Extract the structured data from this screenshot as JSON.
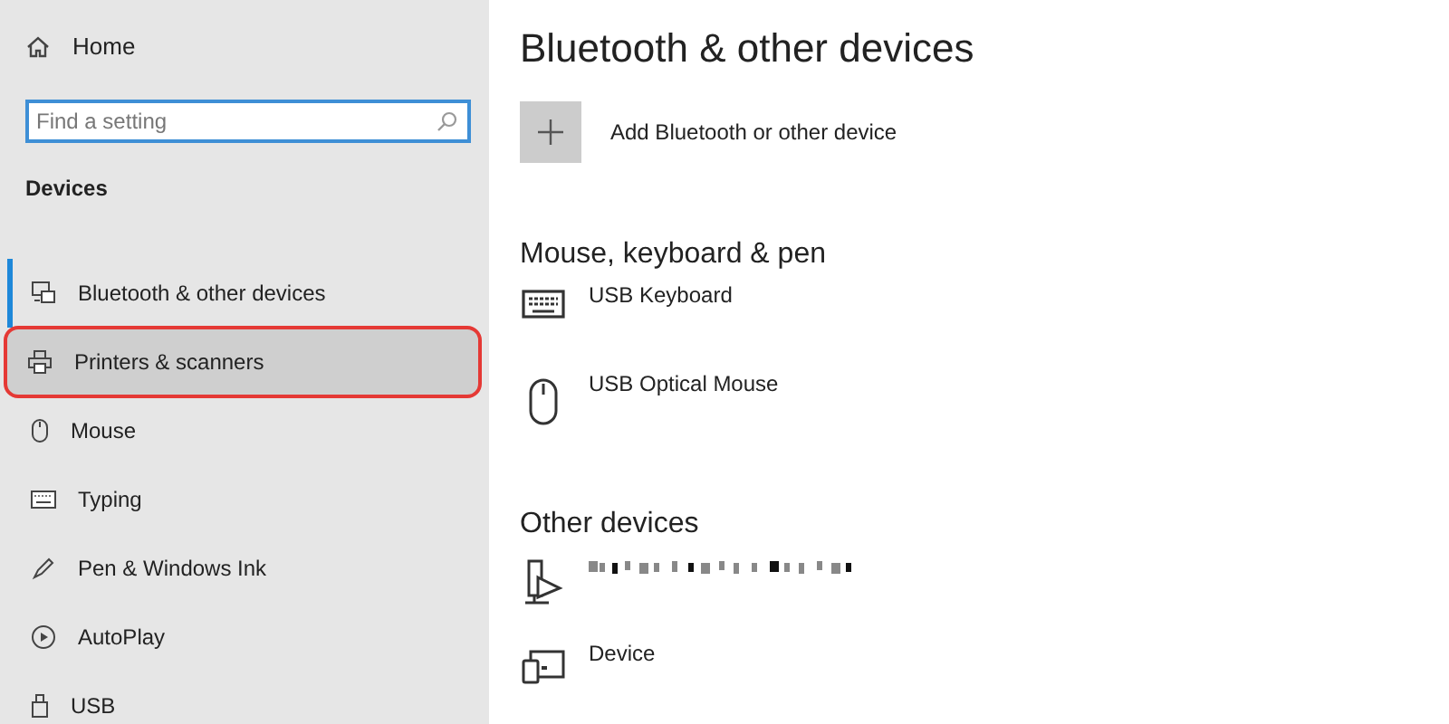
{
  "sidebar": {
    "home": "Home",
    "search": {
      "placeholder": "Find a setting"
    },
    "section": "Devices",
    "items": [
      {
        "label": "Bluetooth & other devices",
        "selected": true,
        "highlighted": false
      },
      {
        "label": "Printers & scanners",
        "selected": false,
        "highlighted": true
      },
      {
        "label": "Mouse",
        "selected": false,
        "highlighted": false
      },
      {
        "label": "Typing",
        "selected": false,
        "highlighted": false
      },
      {
        "label": "Pen & Windows Ink",
        "selected": false,
        "highlighted": false
      },
      {
        "label": "AutoPlay",
        "selected": false,
        "highlighted": false
      },
      {
        "label": "USB",
        "selected": false,
        "highlighted": false
      }
    ]
  },
  "main": {
    "title": "Bluetooth & other devices",
    "add_label": "Add Bluetooth or other device",
    "groups": [
      {
        "heading": "Mouse, keyboard & pen",
        "devices": [
          {
            "kind": "keyboard",
            "name": "USB Keyboard"
          },
          {
            "kind": "mouse",
            "name": "USB Optical Mouse"
          }
        ]
      },
      {
        "heading": "Other devices",
        "devices": [
          {
            "kind": "media",
            "redacted": true
          },
          {
            "kind": "device",
            "name": "Device"
          }
        ]
      }
    ]
  }
}
